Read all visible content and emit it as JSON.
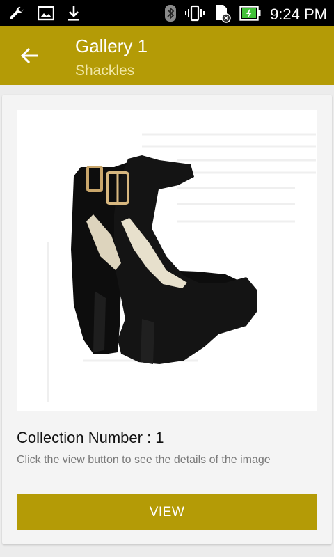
{
  "status_bar": {
    "time": "9:24 PM",
    "icons": [
      "wrench-icon",
      "image-icon",
      "download-icon",
      "bluetooth-icon",
      "vibrate-icon",
      "sd-card-icon",
      "battery-charging-icon"
    ]
  },
  "toolbar": {
    "title": "Gallery 1",
    "subtitle": "Shackles",
    "back_icon": "arrow-left-icon"
  },
  "card": {
    "image_alt_icon": "platform-heel-shoe-image",
    "heading": "Collection Number : 1",
    "description": "Click the view button to see the details of the image",
    "button_label": "VIEW"
  },
  "colors": {
    "accent": "#b49b06",
    "subtitle": "#f1e7a6",
    "background": "#ececec"
  }
}
